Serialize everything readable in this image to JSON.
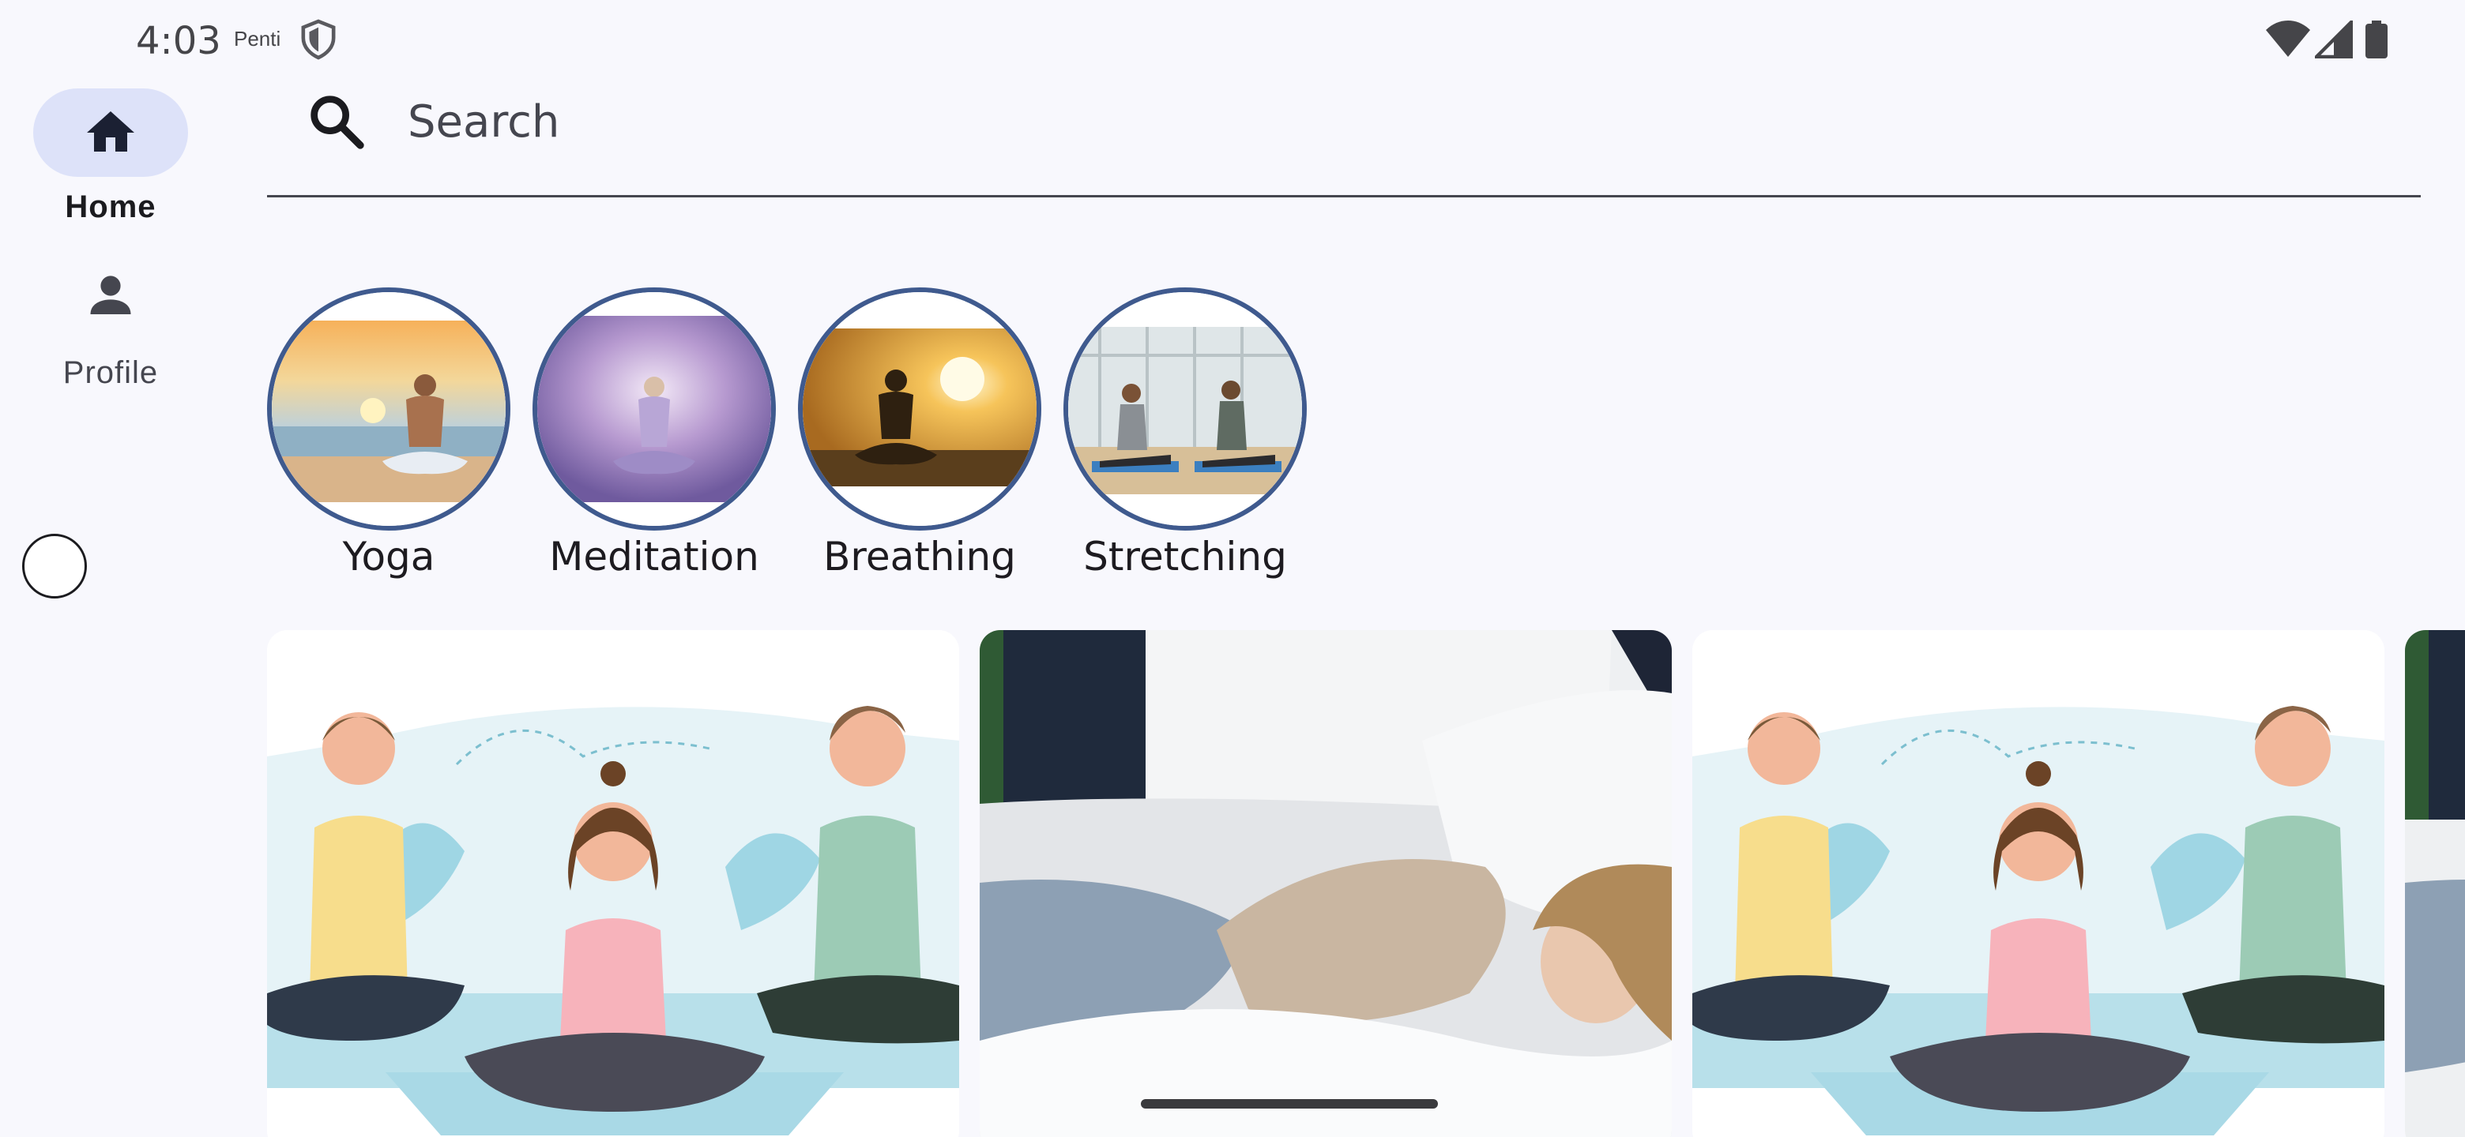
{
  "status_bar": {
    "time": "4:03",
    "carrier": "Penti",
    "icons": [
      "shield-icon",
      "wifi-icon",
      "signal-icon",
      "battery-icon"
    ]
  },
  "nav": {
    "items": [
      {
        "label": "Home",
        "icon": "home-icon",
        "selected": true
      },
      {
        "label": "Profile",
        "icon": "person-icon",
        "selected": false
      }
    ]
  },
  "search": {
    "placeholder": "Search",
    "value": ""
  },
  "categories": [
    {
      "label": "Yoga",
      "image": "man meditating on beach at sunset"
    },
    {
      "label": "Meditation",
      "image": "woman meditating in purple light"
    },
    {
      "label": "Breathing",
      "image": "silhouette meditating at sunset"
    },
    {
      "label": "Stretching",
      "image": "two people stretching in gym"
    }
  ],
  "cards": [
    {
      "image": "illustration of three people doing yoga"
    },
    {
      "image": "woman sleeping in bed"
    },
    {
      "image": "illustration of three people doing yoga"
    },
    {
      "image": "partially visible card"
    }
  ],
  "colors": {
    "background": "#f8f8fd",
    "nav_indicator": "#dde2f9",
    "category_border": "#3f5a8e",
    "search_underline": "#45464f"
  }
}
